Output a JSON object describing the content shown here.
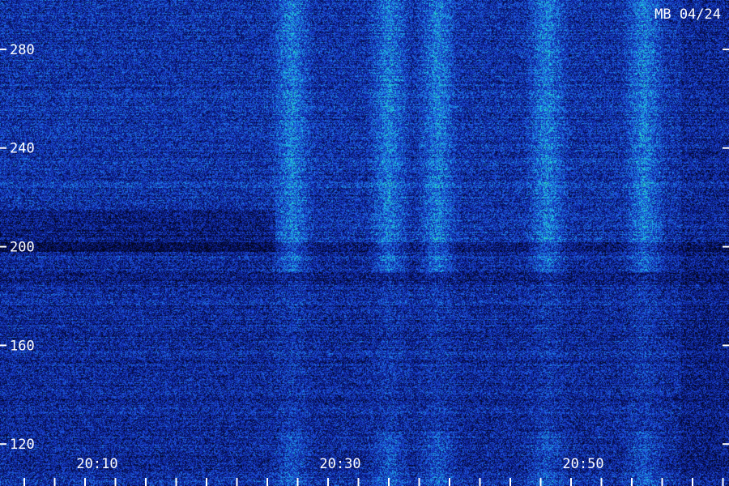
{
  "stamp": "MB 04/24",
  "chart_data": {
    "type": "heatmap",
    "title": "",
    "xlabel": "",
    "ylabel": "",
    "x_tick_labels": [
      "20:10",
      "20:30",
      "20:50"
    ],
    "x_tick_values_min": [
      10,
      30,
      50
    ],
    "xlim_min": [
      2,
      62
    ],
    "y_tick_labels": [
      "120",
      "160",
      "200",
      "240",
      "280"
    ],
    "y_tick_values": [
      120,
      160,
      200,
      240,
      280
    ],
    "ylim": [
      103,
      300
    ],
    "colormap": [
      "#02051a",
      "#0a1a8c",
      "#1f4fe0",
      "#1ec8e6",
      "#3fe86a"
    ],
    "features": {
      "noise_band_hz": [
        [
          185,
          190
        ],
        [
          198,
          202
        ]
      ],
      "bright_columns_min": [
        26,
        34,
        38,
        47,
        55
      ]
    }
  }
}
